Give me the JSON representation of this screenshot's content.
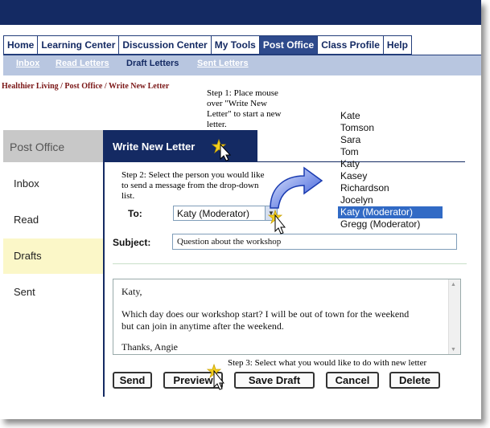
{
  "nav": {
    "tabs": [
      {
        "label": "Home"
      },
      {
        "label": "Learning Center"
      },
      {
        "label": "Discussion Center"
      },
      {
        "label": "My Tools"
      },
      {
        "label": "Post Office"
      },
      {
        "label": "Class Profile"
      },
      {
        "label": "Help"
      }
    ],
    "active_tab": "Post Office",
    "subnav": [
      "Inbox",
      "Read Letters",
      "Draft Letters",
      "Sent Letters"
    ],
    "current_subnav": "Draft Letters"
  },
  "breadcrumb": "Healthier Living / Post Office / Write New Letter",
  "notes": {
    "step1": [
      "Step 1:  Place mouse",
      "over \"Write New",
      "Letter\" to start a new",
      "letter."
    ],
    "step2": [
      "Step 2: Select the person you would like",
      "to send a message from the drop-down",
      "list."
    ],
    "step3": "Step 3: Select what you would like to do with new letter"
  },
  "sidebar": {
    "title": "Post Office",
    "items": [
      "Inbox",
      "Read",
      "Drafts",
      "Sent"
    ],
    "active": "Drafts"
  },
  "compose": {
    "title": "Write New Letter",
    "to_label": "To:",
    "to_value": "Katy (Moderator)",
    "subject_label": "Subject:",
    "subject_value": "Question about the workshop",
    "body_lines": [
      "Katy,",
      "Which day does our workshop start? I will be out of town for the weekend",
      "but can join in anytime after the weekend.",
      "Thanks, Angie"
    ]
  },
  "dropdown": {
    "options": [
      "Kate",
      "Tomson",
      "Sara",
      "Tom",
      "Katy",
      "Kasey",
      "Richardson",
      "Jocelyn",
      "Katy (Moderator)",
      "Gregg (Moderator)"
    ],
    "selected": "Katy (Moderator)"
  },
  "buttons": {
    "send": "Send",
    "preview": "Preview",
    "save_draft": "Save Draft",
    "cancel": "Cancel",
    "delete": "Delete"
  },
  "colors": {
    "banner": "#142a63",
    "active_tab": "#2e4a8c",
    "subnav_bg": "#b8c6e0",
    "breadcrumb": "#7a1616",
    "active_sidebar": "#fbf7c8",
    "dropdown_highlight": "#316ac5"
  }
}
